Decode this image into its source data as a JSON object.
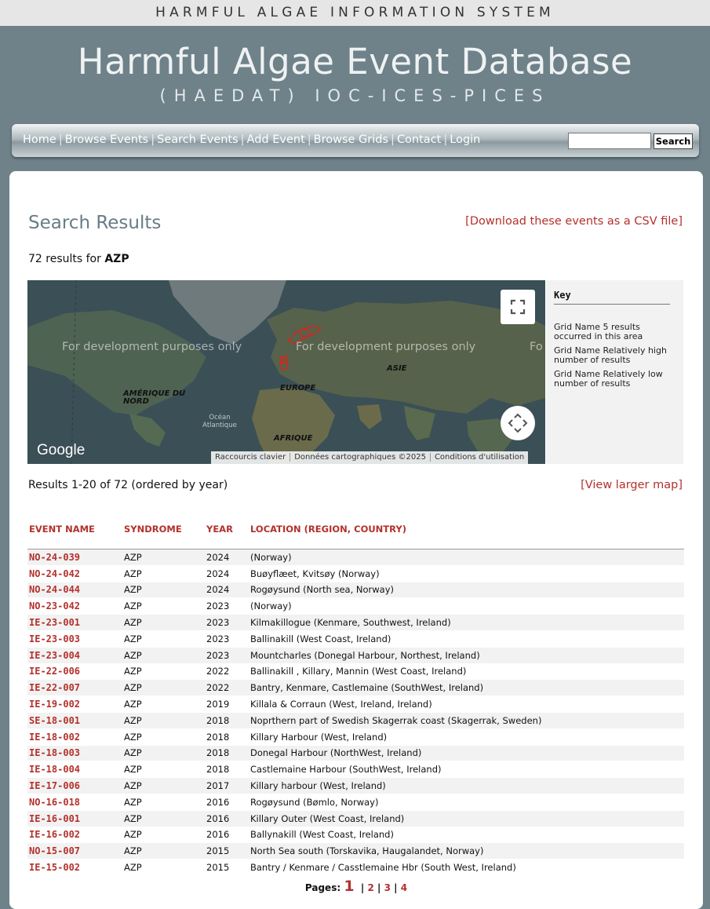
{
  "header": {
    "top_title": "HARMFUL ALGAE INFORMATION SYSTEM",
    "banner_title": "Harmful Algae Event Database",
    "banner_subtitle": "(HAEDAT) IOC-ICES-PICES"
  },
  "nav": {
    "items": [
      "Home",
      "Browse Events",
      "Search Events",
      "Add Event",
      "Browse Grids",
      "Contact",
      "Login"
    ],
    "search_value": "",
    "search_button": "Search"
  },
  "main": {
    "title": "Search Results",
    "csv_link": "[Download these events as a CSV file]",
    "results_prefix": "72 results for ",
    "query": "AZP",
    "range_text": "Results 1-20 of 72 (ordered by year)",
    "larger_map_link": "[View larger map]"
  },
  "map": {
    "watermarks": [
      "For development purposes only",
      "For development purposes only",
      "Fo"
    ],
    "labels": {
      "north_america": "AMÉRIQUE DU NORD",
      "europe": "EUROPE",
      "asia": "ASIE",
      "africa": "AFRIQUE",
      "atlantic": "Océan Atlantique"
    },
    "logo": "Google",
    "attribution": [
      "Raccourcis clavier",
      "Données cartographiques ©2025",
      "Conditions d'utilisation"
    ],
    "fullscreen_icon": "fullscreen-icon",
    "move_icon": "move-arrows-icon",
    "grid_color": "#d9241c"
  },
  "key": {
    "title": "Key",
    "items": [
      "Grid Name 5 results occurred in this area",
      "Grid Name Relatively high number of results",
      "Grid Name Relatively low number of results"
    ]
  },
  "table": {
    "headers": [
      "EVENT NAME",
      "SYNDROME",
      "YEAR",
      "LOCATION (REGION, COUNTRY)"
    ],
    "rows": [
      [
        "NO-24-039",
        "AZP",
        "2024",
        "(Norway)"
      ],
      [
        "NO-24-042",
        "AZP",
        "2024",
        "Buøyflæet, Kvitsøy (Norway)"
      ],
      [
        "NO-24-044",
        "AZP",
        "2024",
        "Rogøysund (North sea, Norway)"
      ],
      [
        "NO-23-042",
        "AZP",
        "2023",
        "(Norway)"
      ],
      [
        "IE-23-001",
        "AZP",
        "2023",
        "Kilmakillogue (Kenmare, Southwest, Ireland)"
      ],
      [
        "IE-23-003",
        "AZP",
        "2023",
        "Ballinakill (West Coast, Ireland)"
      ],
      [
        "IE-23-004",
        "AZP",
        "2023",
        "Mountcharles (Donegal Harbour, Northest, Ireland)"
      ],
      [
        "IE-22-006",
        "AZP",
        "2022",
        "Ballinakill , Killary, Mannin (West Coast, Ireland)"
      ],
      [
        "IE-22-007",
        "AZP",
        "2022",
        "Bantry, Kenmare, Castlemaine (SouthWest, Ireland)"
      ],
      [
        "IE-19-002",
        "AZP",
        "2019",
        "Killala & Corraun (West, Ireland, Ireland)"
      ],
      [
        "SE-18-001",
        "AZP",
        "2018",
        "Noprthern part of Swedish Skagerrak coast (Skagerrak, Sweden)"
      ],
      [
        "IE-18-002",
        "AZP",
        "2018",
        "Killary Harbour (West, Ireland)"
      ],
      [
        "IE-18-003",
        "AZP",
        "2018",
        "Donegal Harbour (NorthWest, Ireland)"
      ],
      [
        "IE-18-004",
        "AZP",
        "2018",
        "Castlemaine Harbour (SouthWest, Ireland)"
      ],
      [
        "IE-17-006",
        "AZP",
        "2017",
        "Killary harbour (West, Ireland)"
      ],
      [
        "NO-16-018",
        "AZP",
        "2016",
        "Rogøysund (Bømlo, Norway)"
      ],
      [
        "IE-16-001",
        "AZP",
        "2016",
        "Killary Outer (West Coast, Ireland)"
      ],
      [
        "IE-16-002",
        "AZP",
        "2016",
        "Ballynakill (West Coast, Ireland)"
      ],
      [
        "NO-15-007",
        "AZP",
        "2015",
        "North Sea south (Torskavika, Haugalandet, Norway)"
      ],
      [
        "IE-15-002",
        "AZP",
        "2015",
        "Bantry / Kenmare / Casstlemaine Hbr (South West, Ireland)"
      ]
    ]
  },
  "pagination": {
    "label": "Pages:",
    "current": "1",
    "pages": [
      "2",
      "3",
      "4"
    ]
  }
}
